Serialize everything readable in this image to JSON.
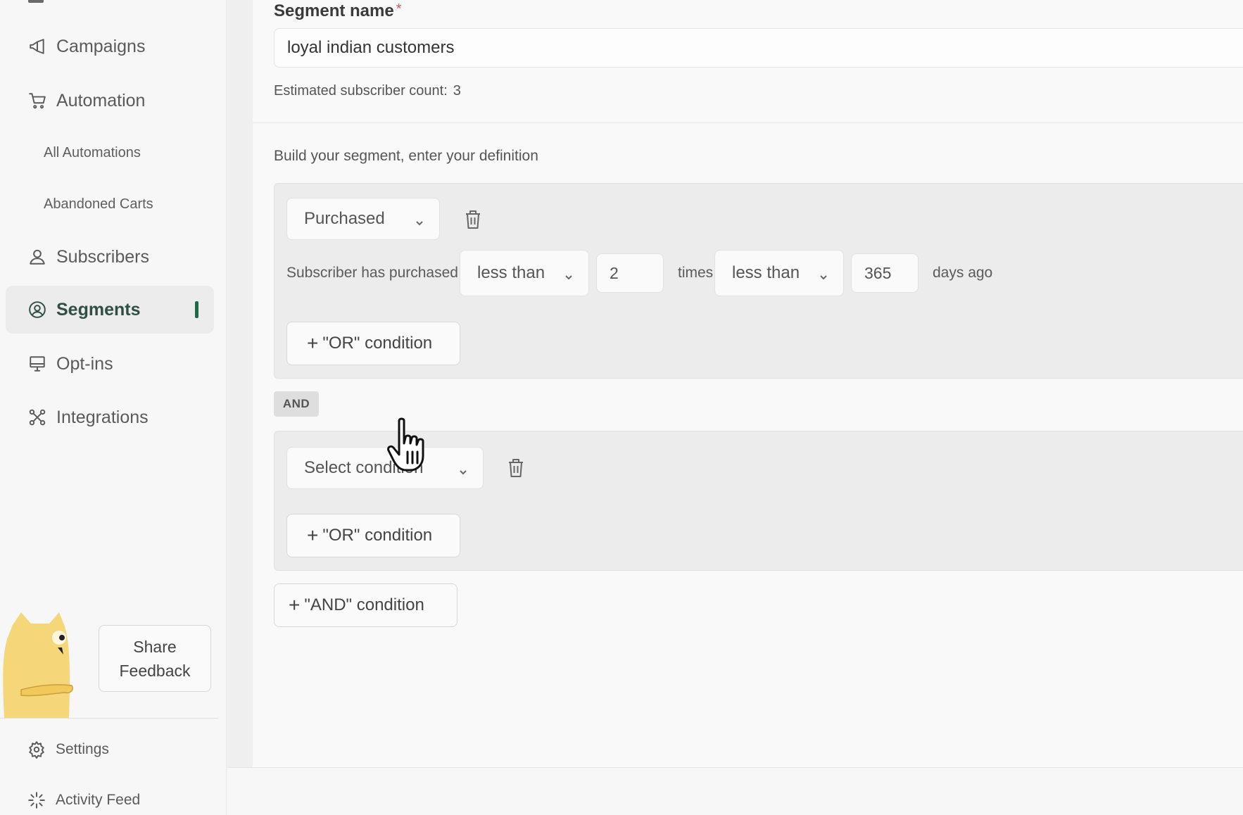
{
  "sidebar": {
    "items": [
      {
        "label": "Campaigns",
        "icon": "megaphone-icon"
      },
      {
        "label": "Automation",
        "icon": "cart-icon"
      },
      {
        "label": "Subscribers",
        "icon": "user-icon"
      },
      {
        "label": "Segments",
        "icon": "user-circle-icon",
        "active": true
      },
      {
        "label": "Opt-ins",
        "icon": "monitor-icon"
      },
      {
        "label": "Integrations",
        "icon": "integrations-icon"
      }
    ],
    "sub_items": [
      "All Automations",
      "Abandoned Carts"
    ],
    "feedback_label_line1": "Share",
    "feedback_label_line2": "Feedback",
    "bottom": [
      {
        "label": "Settings",
        "icon": "gear-icon"
      },
      {
        "label": "Activity Feed",
        "icon": "sparkle-icon"
      }
    ],
    "accent_color": "#1f6b45"
  },
  "main": {
    "segment_name_label": "Segment name",
    "required_mark": "*",
    "segment_name_value": "loyal indian customers",
    "estimate_label": "Estimated subscriber count:",
    "estimate_value": "3",
    "build_label": "Build your segment, enter your definition",
    "group1": {
      "condition": "Purchased",
      "prefix": "Subscriber has purchased",
      "operator1": "less than",
      "count": "2",
      "count_unit": "times",
      "operator2": "less than",
      "days": "365",
      "days_unit": "days ago",
      "or_label": "\"OR\" condition"
    },
    "and_badge": "AND",
    "group2": {
      "condition": "Select condition",
      "or_label": "\"OR\" condition"
    },
    "and_button_label": "\"AND\" condition"
  }
}
